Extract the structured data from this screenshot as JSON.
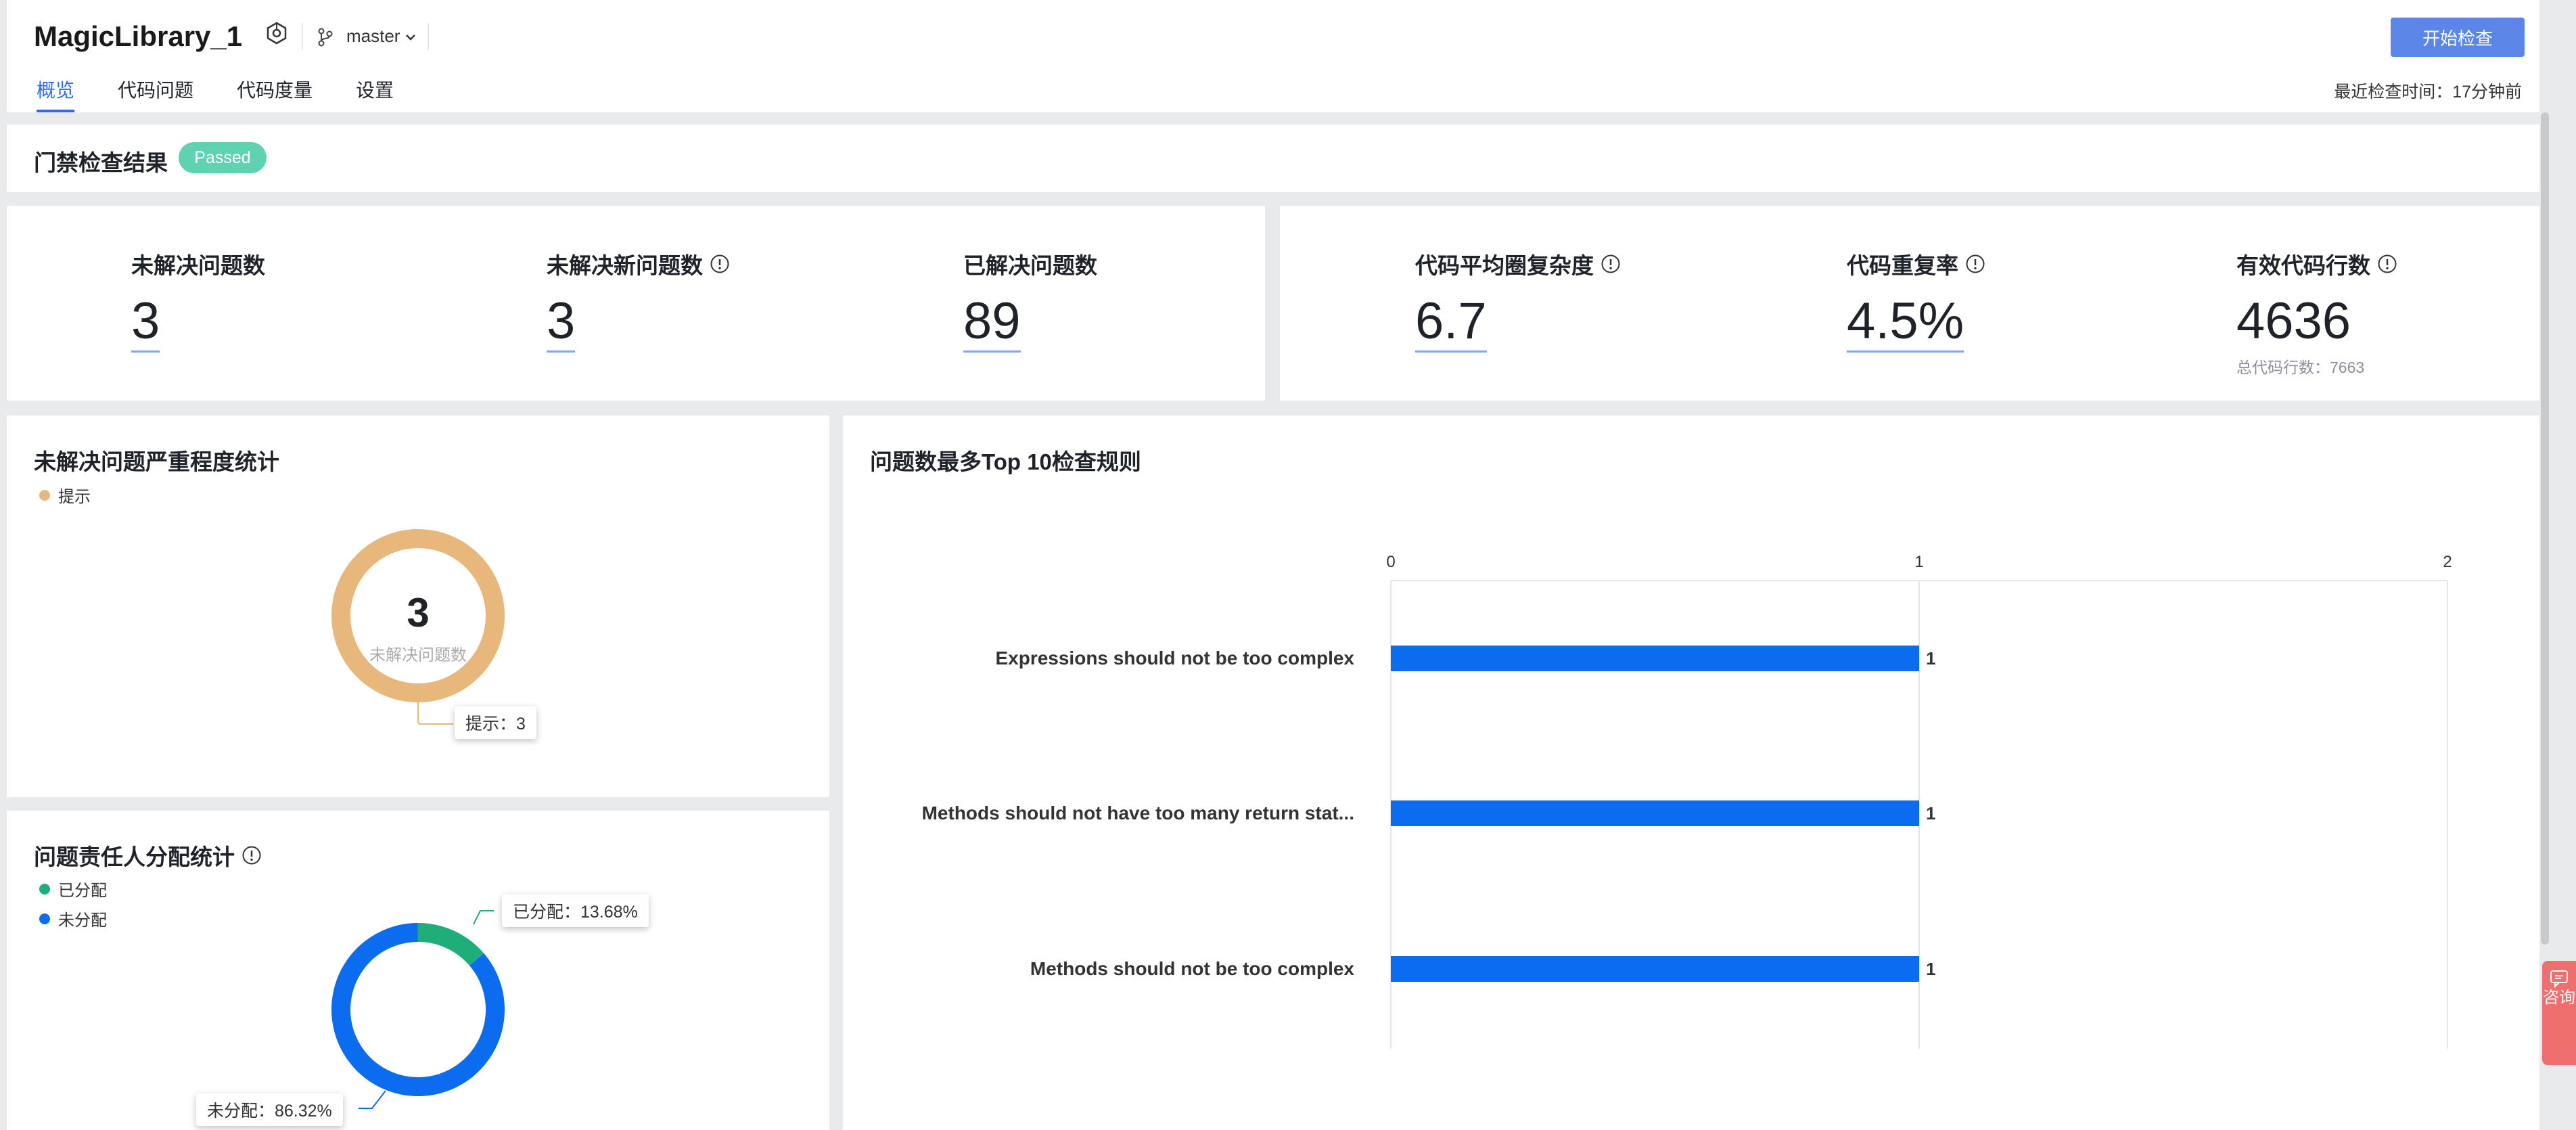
{
  "header": {
    "repo_name": "MagicLibrary_1",
    "branch": "master",
    "tabs": [
      {
        "label": "概览",
        "active": true
      },
      {
        "label": "代码问题",
        "active": false
      },
      {
        "label": "代码度量",
        "active": false
      },
      {
        "label": "设置",
        "active": false
      }
    ],
    "start_button": "开始检查",
    "last_check": "最近检查时间：17分钟前"
  },
  "gate": {
    "title": "门禁检查结果",
    "status": "Passed"
  },
  "metrics": {
    "unresolved": {
      "label": "未解决问题数",
      "value": "3"
    },
    "unresolved_new": {
      "label": "未解决新问题数",
      "value": "3"
    },
    "resolved": {
      "label": "已解决问题数",
      "value": "89"
    },
    "complexity": {
      "label": "代码平均圈复杂度",
      "value": "6.7"
    },
    "duplication": {
      "label": "代码重复率",
      "value": "4.5%"
    },
    "loc": {
      "label": "有效代码行数",
      "value": "4636",
      "sub": "总代码行数：7663"
    }
  },
  "severity": {
    "title": "未解决问题严重程度统计",
    "legend": [
      {
        "label": "提示",
        "color": "#e7b77b"
      }
    ],
    "center_value": "3",
    "center_label": "未解决问题数",
    "tooltip": "提示：3"
  },
  "assign": {
    "title": "问题责任人分配统计",
    "legend": [
      {
        "label": "已分配",
        "color": "#1fae7a"
      },
      {
        "label": "未分配",
        "color": "#0b6cf0"
      }
    ],
    "tooltip_assigned": "已分配：13.68%",
    "tooltip_unassigned": "未分配：86.32%"
  },
  "top10": {
    "title": "问题数最多Top 10检查规则"
  },
  "consult": {
    "label": "咨询"
  },
  "chart_data": [
    {
      "type": "pie",
      "categories": [
        "提示"
      ],
      "values": [
        3
      ],
      "colors": [
        "#e7b77b"
      ]
    },
    {
      "type": "pie",
      "categories": [
        "已分配",
        "未分配"
      ],
      "values": [
        13.68,
        86.32
      ],
      "colors": [
        "#1fae7a",
        "#0b6cf0"
      ]
    },
    {
      "type": "bar",
      "orientation": "horizontal",
      "categories": [
        "Expressions should not be too complex",
        "Methods should not have too many return stat...",
        "Methods should not be too complex"
      ],
      "values": [
        1,
        1,
        1
      ],
      "xlim": [
        0,
        2
      ],
      "xticks": [
        "0",
        "1",
        "2"
      ],
      "color": "#0b6cf0",
      "grid": true
    }
  ]
}
